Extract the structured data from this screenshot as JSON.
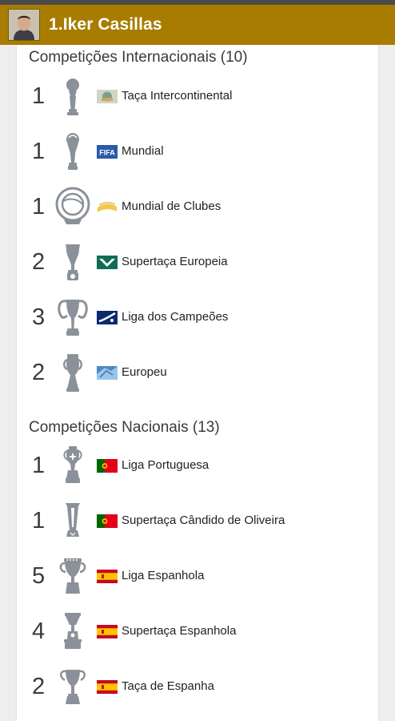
{
  "colors": {
    "header_bg": "#a77c00",
    "trophy": "#8a9199",
    "top_strip": "#4a4a4a"
  },
  "header": {
    "title": "1.Iker Casillas",
    "avatar_icon": "player-photo"
  },
  "sections": [
    {
      "title": "Competições Internacionais (10)",
      "items": [
        {
          "count": "1",
          "name": "Taça Intercontinental",
          "trophy_icon": "intercontinental-cup-icon",
          "logo_icon": "intercontinental-logo-icon"
        },
        {
          "count": "1",
          "name": "Mundial",
          "trophy_icon": "world-cup-icon",
          "logo_icon": "fifa-logo-icon",
          "logo_text": "FIFA"
        },
        {
          "count": "1",
          "name": "Mundial de Clubes",
          "trophy_icon": "club-world-cup-icon",
          "logo_icon": "club-world-cup-logo-icon"
        },
        {
          "count": "2",
          "name": "Supertaça Europeia",
          "trophy_icon": "super-cup-icon",
          "logo_icon": "uefa-logo-icon"
        },
        {
          "count": "3",
          "name": "Liga dos Campeões",
          "trophy_icon": "champions-cup-icon",
          "logo_icon": "champions-league-logo-icon"
        },
        {
          "count": "2",
          "name": "Europeu",
          "trophy_icon": "euro-cup-icon",
          "logo_icon": "euro-logo-icon"
        }
      ]
    },
    {
      "title": "Competições Nacionais (13)",
      "items": [
        {
          "count": "1",
          "name": "Liga Portuguesa",
          "trophy_icon": "portuguese-league-trophy-icon",
          "logo_icon": "portugal-flag-icon"
        },
        {
          "count": "1",
          "name": "Supertaça Cândido de Oliveira",
          "trophy_icon": "portuguese-supercup-trophy-icon",
          "logo_icon": "portugal-flag-icon"
        },
        {
          "count": "5",
          "name": "Liga Espanhola",
          "trophy_icon": "la-liga-trophy-icon",
          "logo_icon": "spain-flag-icon"
        },
        {
          "count": "4",
          "name": "Supertaça Espanhola",
          "trophy_icon": "spanish-supercup-trophy-icon",
          "logo_icon": "spain-flag-icon"
        },
        {
          "count": "2",
          "name": "Taça de Espanha",
          "trophy_icon": "copa-del-rey-trophy-icon",
          "logo_icon": "spain-flag-icon"
        }
      ]
    }
  ]
}
